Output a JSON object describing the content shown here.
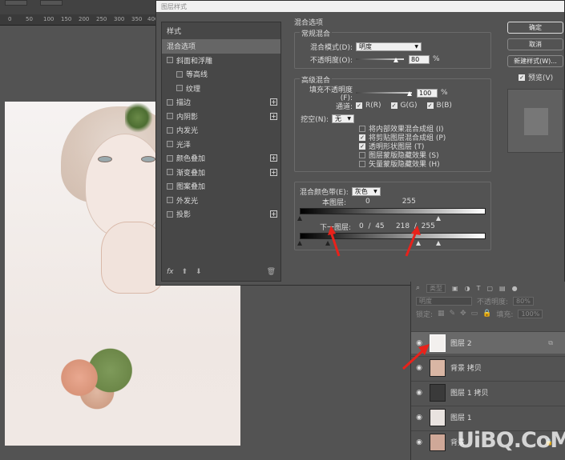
{
  "workspace": {
    "ruler_marks": [
      "0",
      "50",
      "100",
      "150",
      "200",
      "250",
      "300",
      "350",
      "400"
    ]
  },
  "dialog": {
    "title": "图层样式",
    "styles_header": "样式",
    "styles": [
      {
        "label": "混合选项",
        "checkbox": false,
        "active": true,
        "sub": false,
        "plus": false
      },
      {
        "label": "斜面和浮雕",
        "checkbox": true,
        "checked": false,
        "sub": false,
        "plus": false
      },
      {
        "label": "等高线",
        "checkbox": true,
        "checked": false,
        "sub": true,
        "plus": false
      },
      {
        "label": "纹理",
        "checkbox": true,
        "checked": false,
        "sub": true,
        "plus": false
      },
      {
        "label": "描边",
        "checkbox": true,
        "checked": false,
        "sub": false,
        "plus": true
      },
      {
        "label": "内阴影",
        "checkbox": true,
        "checked": false,
        "sub": false,
        "plus": true
      },
      {
        "label": "内发光",
        "checkbox": true,
        "checked": false,
        "sub": false,
        "plus": false
      },
      {
        "label": "光泽",
        "checkbox": true,
        "checked": false,
        "sub": false,
        "plus": false
      },
      {
        "label": "颜色叠加",
        "checkbox": true,
        "checked": false,
        "sub": false,
        "plus": true
      },
      {
        "label": "渐变叠加",
        "checkbox": true,
        "checked": false,
        "sub": false,
        "plus": true
      },
      {
        "label": "图案叠加",
        "checkbox": true,
        "checked": false,
        "sub": false,
        "plus": false
      },
      {
        "label": "外发光",
        "checkbox": true,
        "checked": false,
        "sub": false,
        "plus": false
      },
      {
        "label": "投影",
        "checkbox": true,
        "checked": false,
        "sub": false,
        "plus": true
      }
    ],
    "fx_label": "fx",
    "blending": {
      "title": "混合选项",
      "general_title": "常规混合",
      "blend_mode_label": "混合模式(D):",
      "blend_mode_value": "明度",
      "opacity_label": "不透明度(O):",
      "opacity_value": "80",
      "percent": "%",
      "advanced_title": "高级混合",
      "fill_opacity_label": "填充不透明度(F):",
      "fill_opacity_value": "100",
      "channels_label": "通道:",
      "channel_r": "R(R)",
      "channel_g": "G(G)",
      "channel_b": "B(B)",
      "knockout_label": "挖空(N):",
      "knockout_value": "无",
      "options": [
        {
          "label": "将内部效果混合成组 (I)",
          "checked": false
        },
        {
          "label": "将剪贴图层混合成组 (P)",
          "checked": true
        },
        {
          "label": "透明形状图层 (T)",
          "checked": true
        },
        {
          "label": "图层蒙版隐藏效果 (S)",
          "checked": false
        },
        {
          "label": "矢量蒙版隐藏效果 (H)",
          "checked": false
        }
      ],
      "blend_if_label": "混合颜色带(E):",
      "blend_if_value": "灰色",
      "this_layer_label": "本图层:",
      "this_layer_low": "0",
      "this_layer_high": "255",
      "underlying_label": "下一图层:",
      "underlying_values": "0  /  45     218  /  255"
    },
    "buttons": {
      "ok": "确定",
      "cancel": "取消",
      "new_style": "新建样式(W)...",
      "preview": "预览(V)"
    }
  },
  "layers_panel": {
    "filter_kind": "类型",
    "blend_mode": "明度",
    "opacity_label": "不透明度:",
    "opacity_value": "80%",
    "lock_label": "锁定:",
    "fill_label": "填充:",
    "fill_value": "100%",
    "layers": [
      {
        "name": "图层 2",
        "selected": true
      },
      {
        "name": "背景 拷贝",
        "selected": false
      },
      {
        "name": "图层 1 拷贝",
        "selected": false
      },
      {
        "name": "图层 1",
        "selected": false
      },
      {
        "name": "背景",
        "selected": false
      }
    ]
  },
  "watermark": "UiBQ.CoM",
  "colors": {
    "arrow": "#e8221b",
    "panel_bg": "#535353",
    "selected_row": "#696969"
  }
}
